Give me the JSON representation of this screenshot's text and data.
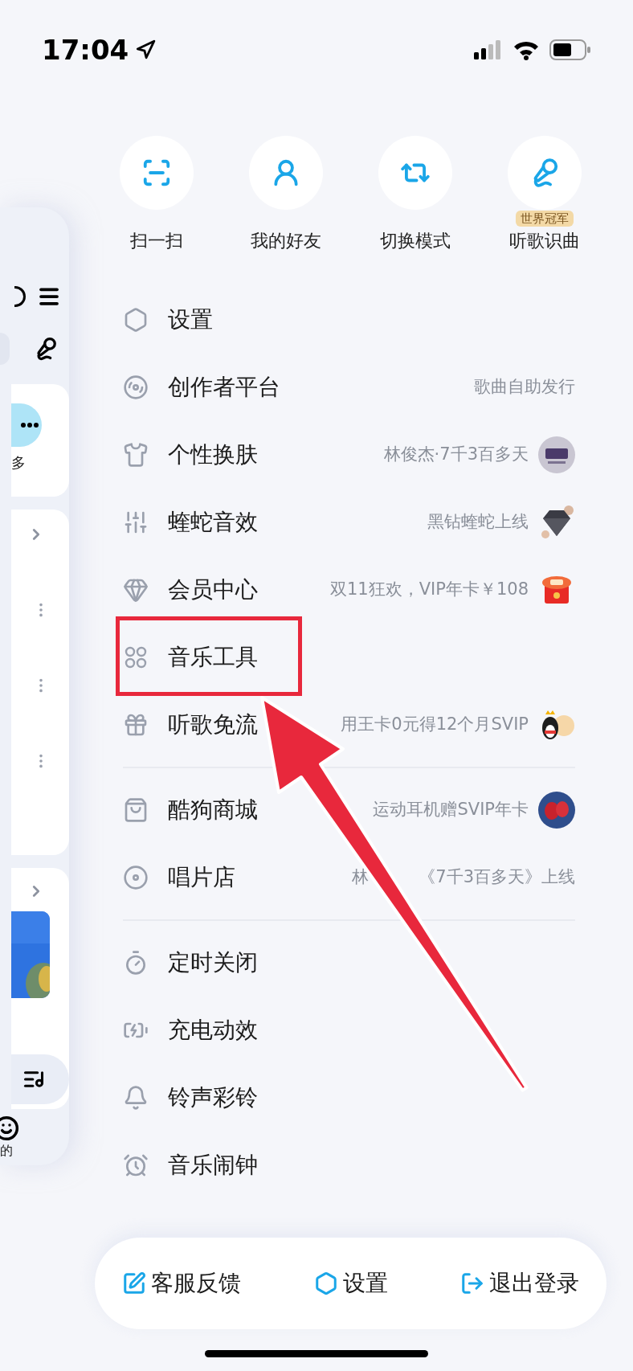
{
  "status_bar": {
    "time": "17:04"
  },
  "drawer_preview": {
    "more_label": "多",
    "mine_label": "的"
  },
  "quick_actions": [
    {
      "label": "扫一扫"
    },
    {
      "label": "我的好友"
    },
    {
      "label": "切换模式"
    },
    {
      "label": "听歌识曲",
      "badge": "世界冠军"
    }
  ],
  "menu_sections": [
    [
      {
        "label": "设置"
      },
      {
        "label": "创作者平台",
        "subtitle": "歌曲自助发行"
      },
      {
        "label": "个性换肤",
        "subtitle": "林俊杰·7千3百多天",
        "thumb": true
      },
      {
        "label": "蝰蛇音效",
        "subtitle": "黑钻蝰蛇上线",
        "thumb": true
      },
      {
        "label": "会员中心",
        "subtitle": "双11狂欢，VIP年卡￥108",
        "thumb": true
      },
      {
        "label": "音乐工具"
      },
      {
        "label": "听歌免流",
        "subtitle": "用王卡0元得12个月SVIP",
        "thumb": true
      }
    ],
    [
      {
        "label": "酷狗商城",
        "subtitle": "运动耳机赠SVIP年卡",
        "thumb": true
      },
      {
        "label": "唱片店",
        "subtitle": "《7千3百多天》上线",
        "subtitle_lead": "林"
      }
    ],
    [
      {
        "label": "定时关闭"
      },
      {
        "label": "充电动效"
      },
      {
        "label": "铃声彩铃"
      },
      {
        "label": "音乐闹钟"
      }
    ]
  ],
  "bottom_bar": [
    {
      "label": "客服反馈"
    },
    {
      "label": "设置"
    },
    {
      "label": "退出登录"
    }
  ]
}
